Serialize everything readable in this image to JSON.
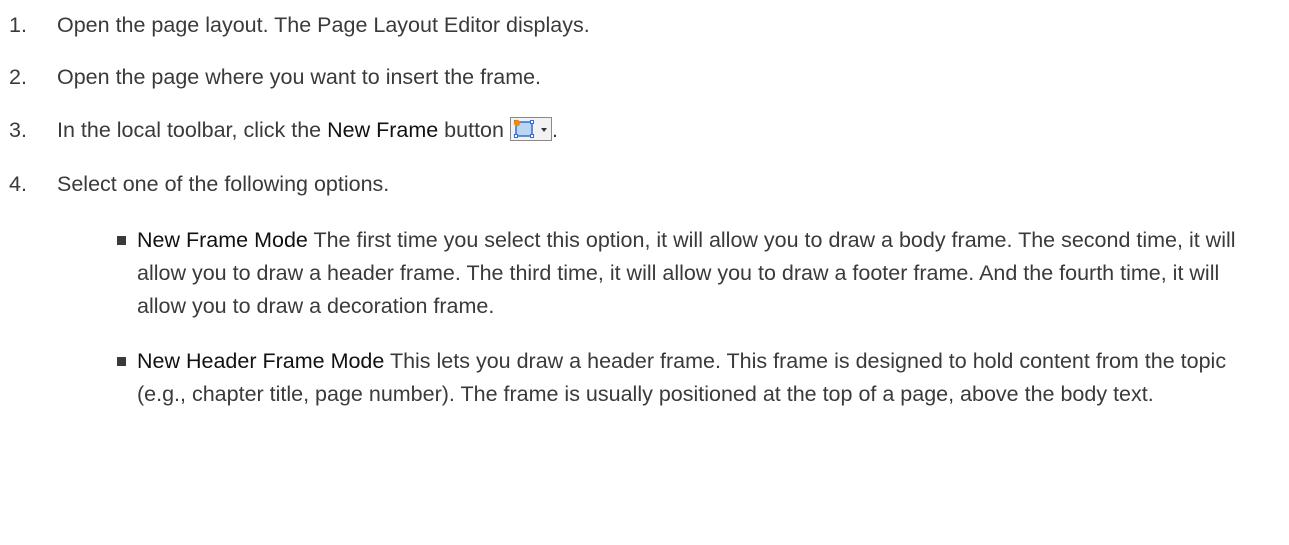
{
  "steps": [
    {
      "num": "1.",
      "text": "Open the page layout. The Page Layout Editor displays."
    },
    {
      "num": "2.",
      "text": "Open the page where you want to insert the frame."
    },
    {
      "num": "3.",
      "text_before": "In the local toolbar, click the ",
      "strong": "New Frame",
      "text_after": " button",
      "text_end": "."
    },
    {
      "num": "4.",
      "text": "Select one of the following options.",
      "options": [
        {
          "title": "New Frame Mode",
          "text": " The first time you select this option, it will allow you to draw a body frame. The second time, it will allow you to draw a header frame. The third time, it will allow you to draw a footer frame. And the fourth time, it will allow you to draw a decoration frame."
        },
        {
          "title": "New Header Frame Mode",
          "text": " This lets you draw a header frame. This frame is designed to hold content from the topic (e.g., chapter title, page number). The frame is usually positioned at the top of a page, above the body text."
        }
      ]
    }
  ],
  "icons": {
    "new_frame": "new-frame-dropdown-icon",
    "frame_blue": "#2f6fd6",
    "frame_fill": "#bcd6f2",
    "star_color": "#f08a00"
  }
}
